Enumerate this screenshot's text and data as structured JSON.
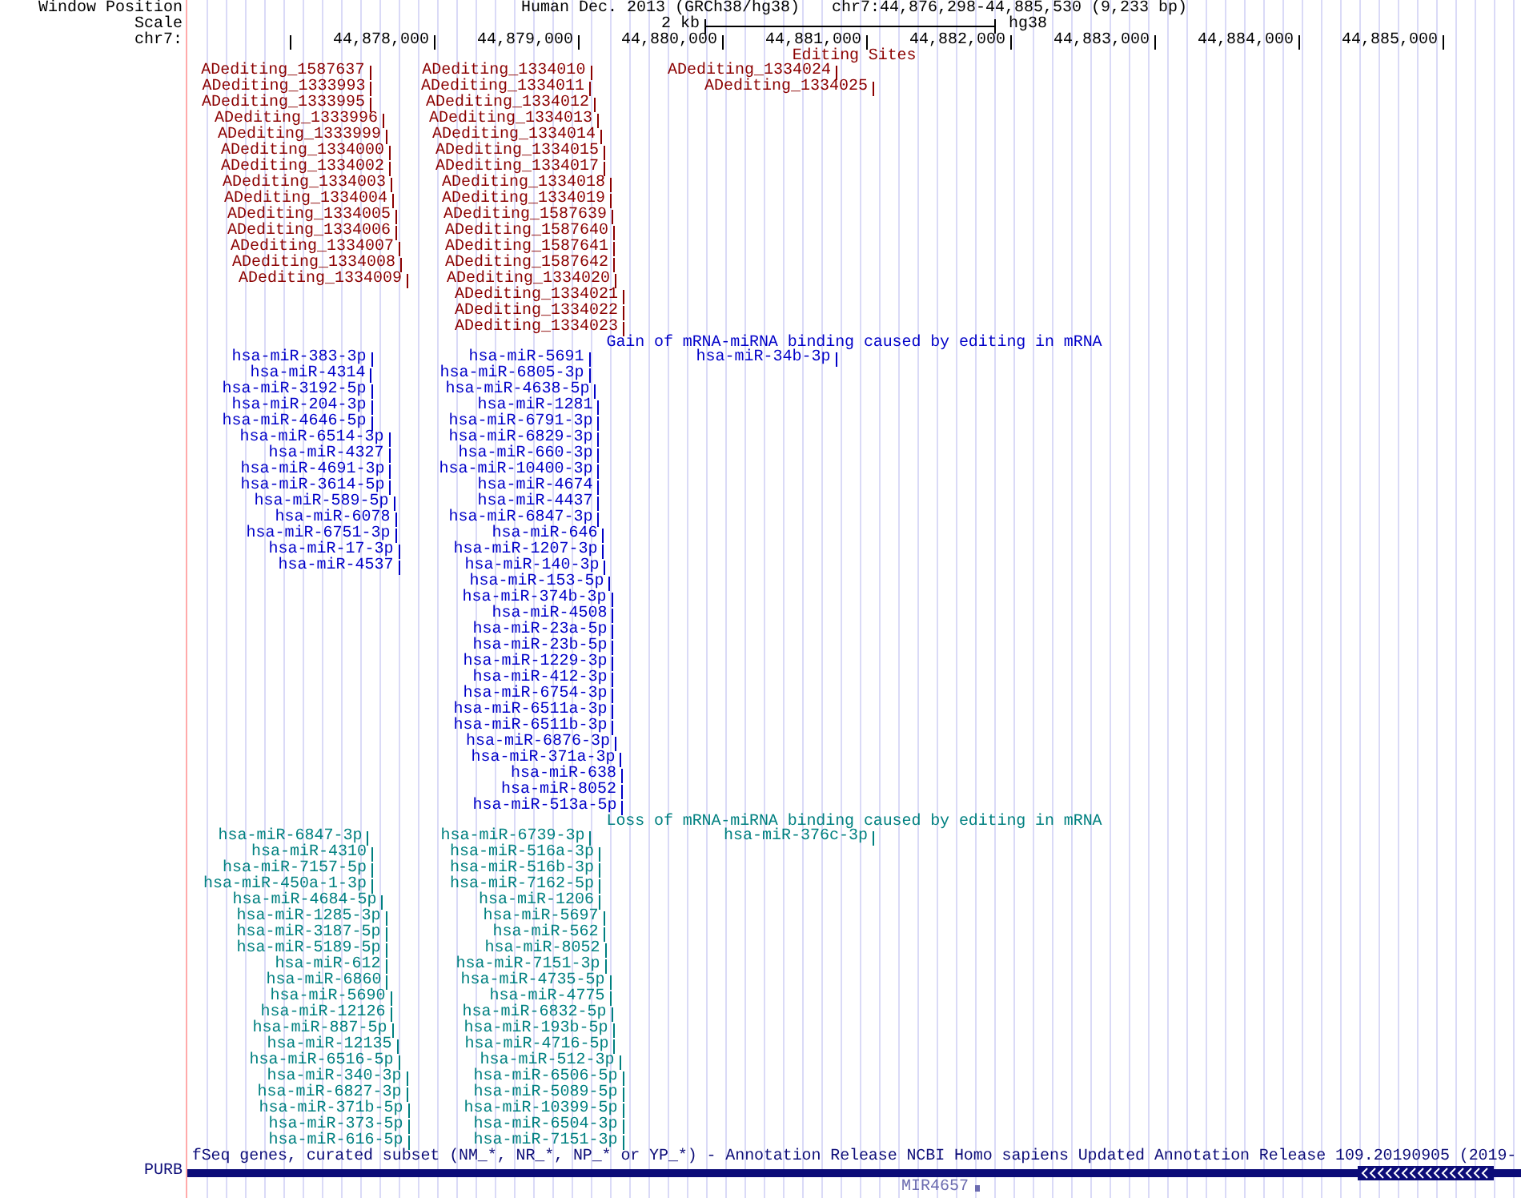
{
  "header": {
    "position_label": "Window Position",
    "assembly": "Human Dec. 2013 (GRCh38/hg38)",
    "position": "chr7:44,876,298-44,885,530 (9,233 bp)",
    "scale_label": "Scale",
    "scale_length": "2 kb",
    "scale_assembly": "hg38",
    "chrom_label": "chr7:",
    "ruler_labels": [
      "44,878,000",
      "44,879,000",
      "44,880,000",
      "44,881,000",
      "44,882,000",
      "44,883,000",
      "44,884,000",
      "44,885,000"
    ]
  },
  "tracks": [
    {
      "kind": "sites",
      "title": "Editing Sites",
      "color": "#8b0000",
      "rows": [
        [
          "ADediting_1587637",
          "ADediting_1334010",
          "ADediting_1334024"
        ],
        [
          "ADediting_1333993",
          "ADediting_1334011",
          "ADediting_1334025"
        ],
        [
          "ADediting_1333995",
          "ADediting_1334012"
        ],
        [
          "ADediting_1333996",
          "ADediting_1334013"
        ],
        [
          "ADediting_1333999",
          "ADediting_1334014"
        ],
        [
          "ADediting_1334000",
          "ADediting_1334015"
        ],
        [
          "ADediting_1334002",
          "ADediting_1334017"
        ],
        [
          "ADediting_1334003",
          "ADediting_1334018"
        ],
        [
          "ADediting_1334004",
          "ADediting_1334019"
        ],
        [
          "ADediting_1334005",
          "ADediting_1587639"
        ],
        [
          "ADediting_1334006",
          "ADediting_1587640"
        ],
        [
          "ADediting_1334007",
          "ADediting_1587641"
        ],
        [
          "ADediting_1334008",
          "ADediting_1587642"
        ],
        [
          "ADediting_1334009",
          "ADediting_1334020"
        ],
        [
          "ADediting_1334021"
        ],
        [
          "ADediting_1334022"
        ],
        [
          "ADediting_1334023"
        ]
      ]
    },
    {
      "kind": "sites",
      "title": "Gain of mRNA-miRNA binding caused by editing in mRNA",
      "color": "#0000c8",
      "rows": [
        [
          "hsa-miR-383-3p",
          "hsa-miR-5691",
          "hsa-miR-34b-3p"
        ],
        [
          "hsa-miR-4314",
          "hsa-miR-6805-3p"
        ],
        [
          "hsa-miR-3192-5p",
          "hsa-miR-4638-5p"
        ],
        [
          "hsa-miR-204-3p",
          "hsa-miR-1281"
        ],
        [
          "hsa-miR-4646-5p",
          "hsa-miR-6791-3p"
        ],
        [
          "hsa-miR-6514-3p",
          "hsa-miR-6829-3p"
        ],
        [
          "hsa-miR-4327",
          "hsa-miR-660-3p"
        ],
        [
          "hsa-miR-4691-3p",
          "hsa-miR-10400-3p"
        ],
        [
          "hsa-miR-3614-5p",
          "hsa-miR-4674"
        ],
        [
          "hsa-miR-589-5p",
          "hsa-miR-4437"
        ],
        [
          "hsa-miR-6078",
          "hsa-miR-6847-3p"
        ],
        [
          "hsa-miR-6751-3p",
          "hsa-miR-646"
        ],
        [
          "hsa-miR-17-3p",
          "hsa-miR-1207-3p"
        ],
        [
          "hsa-miR-4537",
          "hsa-miR-140-3p"
        ],
        [
          "hsa-miR-153-5p"
        ],
        [
          "hsa-miR-374b-3p"
        ],
        [
          "hsa-miR-4508"
        ],
        [
          "hsa-miR-23a-5p"
        ],
        [
          "hsa-miR-23b-5p"
        ],
        [
          "hsa-miR-1229-3p"
        ],
        [
          "hsa-miR-412-3p"
        ],
        [
          "hsa-miR-6754-3p"
        ],
        [
          "hsa-miR-6511a-3p"
        ],
        [
          "hsa-miR-6511b-3p"
        ],
        [
          "hsa-miR-6876-3p"
        ],
        [
          "hsa-miR-371a-3p"
        ],
        [
          "hsa-miR-638"
        ],
        [
          "hsa-miR-8052"
        ],
        [
          "hsa-miR-513a-5p"
        ]
      ]
    },
    {
      "kind": "sites",
      "title": "Loss of mRNA-miRNA binding caused by editing in mRNA",
      "color": "#008080",
      "rows": [
        [
          "hsa-miR-6847-3p",
          "hsa-miR-6739-3p",
          "hsa-miR-376c-3p"
        ],
        [
          "hsa-miR-4310",
          "hsa-miR-516a-3p"
        ],
        [
          "hsa-miR-7157-5p",
          "hsa-miR-516b-3p"
        ],
        [
          "hsa-miR-450a-1-3p",
          "hsa-miR-7162-5p"
        ],
        [
          "hsa-miR-4684-5p",
          "hsa-miR-1206"
        ],
        [
          "hsa-miR-1285-3p",
          "hsa-miR-5697"
        ],
        [
          "hsa-miR-3187-5p",
          "hsa-miR-562"
        ],
        [
          "hsa-miR-5189-5p",
          "hsa-miR-8052"
        ],
        [
          "hsa-miR-612",
          "hsa-miR-7151-3p"
        ],
        [
          "hsa-miR-6860",
          "hsa-miR-4735-5p"
        ],
        [
          "hsa-miR-5690",
          "hsa-miR-4775"
        ],
        [
          "hsa-miR-12126",
          "hsa-miR-6832-5p"
        ],
        [
          "hsa-miR-887-5p",
          "hsa-miR-193b-5p"
        ],
        [
          "hsa-miR-12135",
          "hsa-miR-4716-5p"
        ],
        [
          "hsa-miR-6516-5p",
          "hsa-miR-512-3p"
        ],
        [
          "hsa-miR-340-3p",
          "hsa-miR-6506-5p"
        ],
        [
          "hsa-miR-6827-3p",
          "hsa-miR-5089-5p"
        ],
        [
          "hsa-miR-371b-5p",
          "hsa-miR-10399-5p"
        ],
        [
          "hsa-miR-373-5p",
          "hsa-miR-6504-3p"
        ],
        [
          "hsa-miR-616-5p",
          "hsa-miR-7151-3p"
        ]
      ]
    },
    {
      "kind": "genes",
      "title": "fSeq genes, curated subset (NM_*, NR_*, NP_* or YP_*) - Annotation Release NCBI Homo sapiens Updated Annotation Release 109.20190905 (2019-",
      "color": "#0c0c78",
      "genes": [
        {
          "kind": "spanning",
          "name": "PURB",
          "color": "#0c0c78",
          "reverse": true
        },
        {
          "kind": "compact",
          "name": "MIR4657",
          "color": "#6c6cb0"
        }
      ]
    }
  ]
}
